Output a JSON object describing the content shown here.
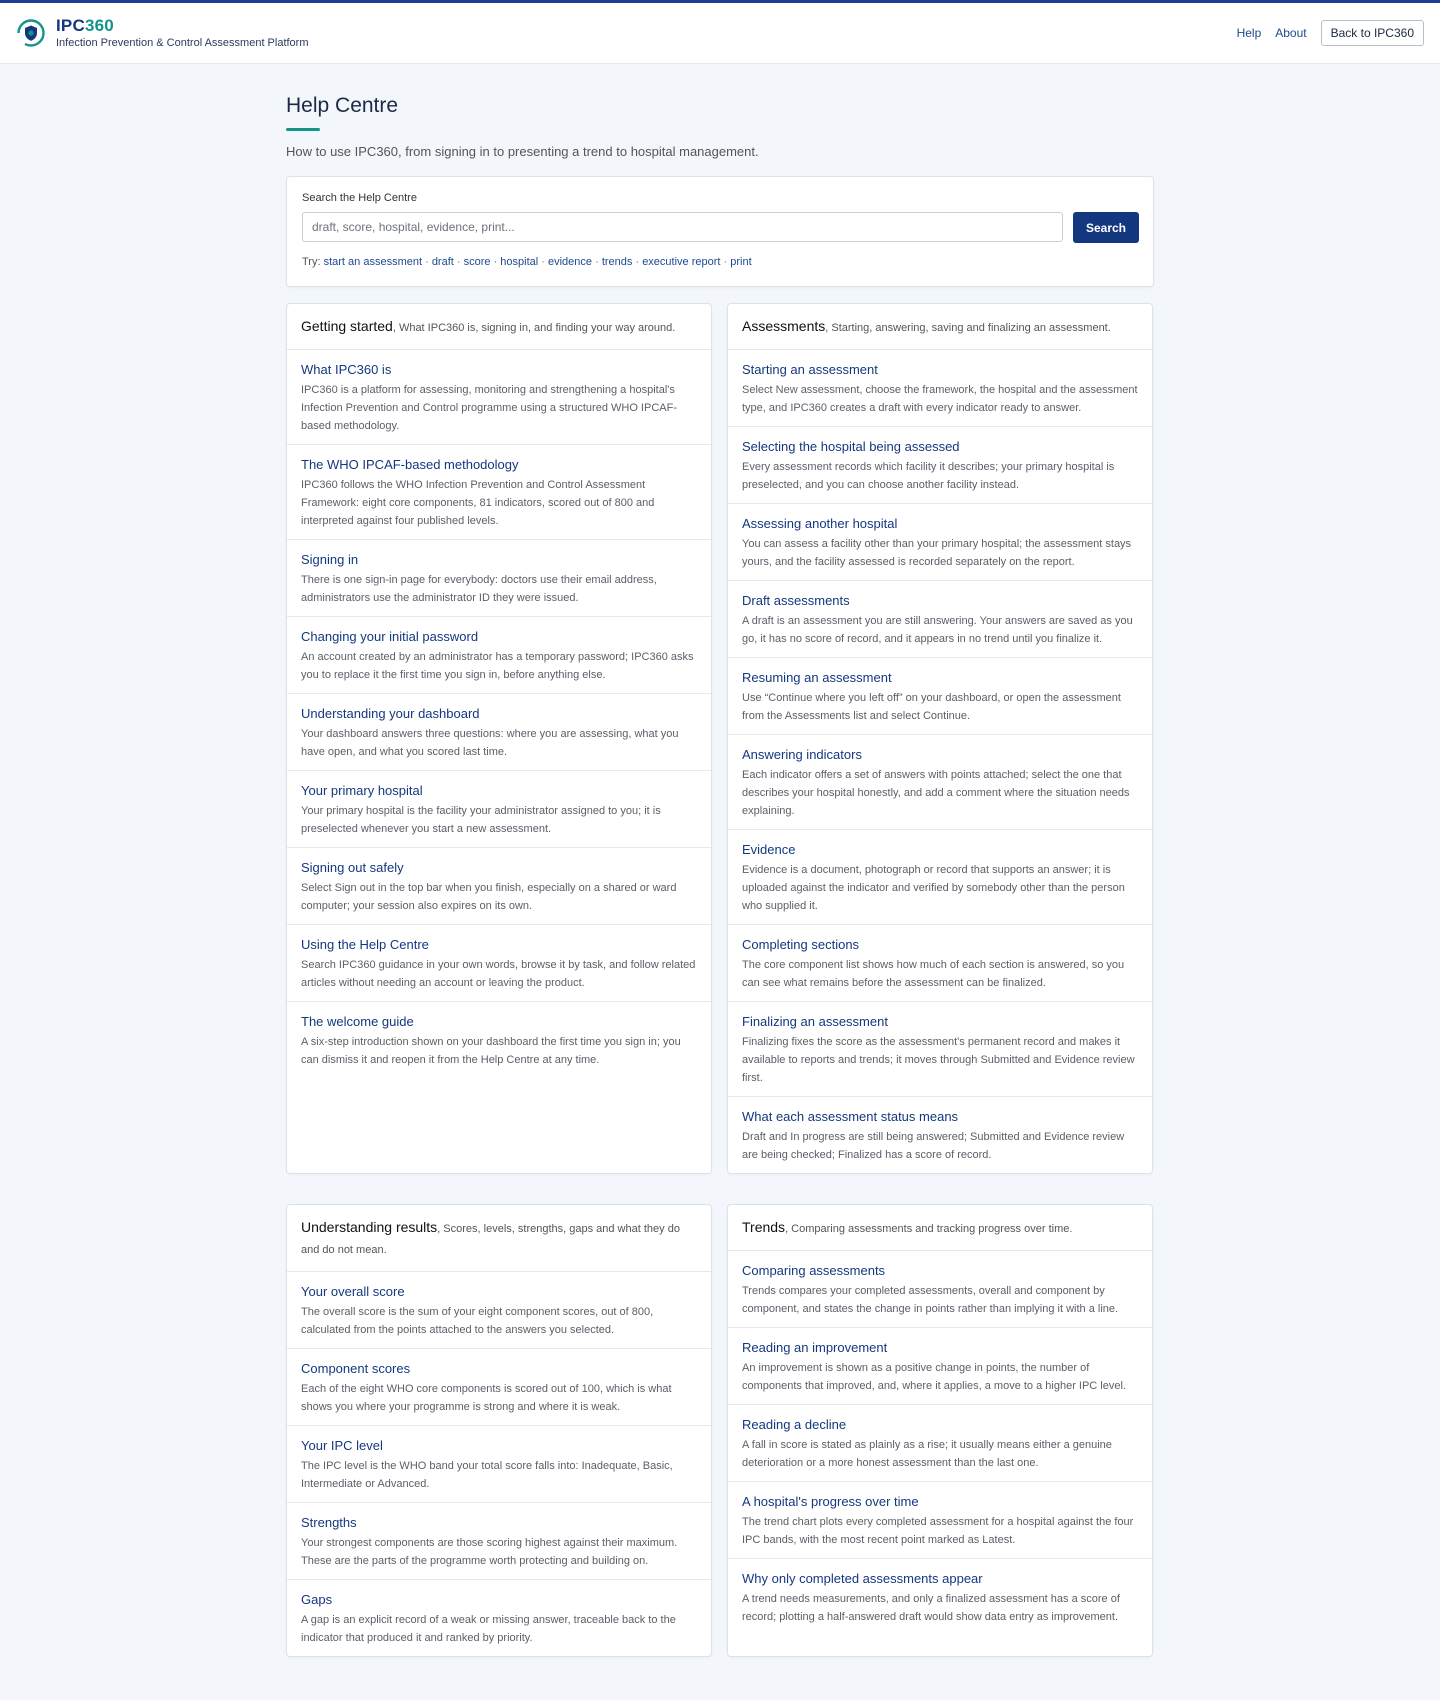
{
  "header": {
    "brand_main": "IPC",
    "brand_accent": "360",
    "brand_sub": "Infection Prevention & Control Assessment Platform",
    "nav_help": "Help",
    "nav_about": "About",
    "back_button": "Back to IPC360"
  },
  "page": {
    "title": "Help Centre",
    "intro": "How to use IPC360, from signing in to presenting a trend to hospital management."
  },
  "search": {
    "label": "Search the Help Centre",
    "placeholder": "draft, score, hospital, evidence, print...",
    "button": "Search",
    "try_label": "Try:",
    "suggestions": [
      "start an assessment",
      "draft",
      "score",
      "hospital",
      "evidence",
      "trends",
      "executive report",
      "print"
    ]
  },
  "sections": [
    {
      "title": "Getting started",
      "desc": ", What IPC360 is, signing in, and finding your way around.",
      "articles": [
        {
          "title": "What IPC360 is",
          "desc": "IPC360 is a platform for assessing, monitoring and strengthening a hospital's Infection Prevention and Control programme using a structured WHO IPCAF-based methodology."
        },
        {
          "title": "The WHO IPCAF-based methodology",
          "desc": "IPC360 follows the WHO Infection Prevention and Control Assessment Framework: eight core components, 81 indicators, scored out of 800 and interpreted against four published levels."
        },
        {
          "title": "Signing in",
          "desc": "There is one sign-in page for everybody: doctors use their email address, administrators use the administrator ID they were issued."
        },
        {
          "title": "Changing your initial password",
          "desc": "An account created by an administrator has a temporary password; IPC360 asks you to replace it the first time you sign in, before anything else."
        },
        {
          "title": "Understanding your dashboard",
          "desc": "Your dashboard answers three questions: where you are assessing, what you have open, and what you scored last time."
        },
        {
          "title": "Your primary hospital",
          "desc": "Your primary hospital is the facility your administrator assigned to you; it is preselected whenever you start a new assessment."
        },
        {
          "title": "Signing out safely",
          "desc": "Select Sign out in the top bar when you finish, especially on a shared or ward computer; your session also expires on its own."
        },
        {
          "title": "Using the Help Centre",
          "desc": "Search IPC360 guidance in your own words, browse it by task, and follow related articles without needing an account or leaving the product."
        },
        {
          "title": "The welcome guide",
          "desc": "A six-step introduction shown on your dashboard the first time you sign in; you can dismiss it and reopen it from the Help Centre at any time."
        }
      ]
    },
    {
      "title": "Assessments",
      "desc": ", Starting, answering, saving and finalizing an assessment.",
      "articles": [
        {
          "title": "Starting an assessment",
          "desc": "Select New assessment, choose the framework, the hospital and the assessment type, and IPC360 creates a draft with every indicator ready to answer."
        },
        {
          "title": "Selecting the hospital being assessed",
          "desc": "Every assessment records which facility it describes; your primary hospital is preselected, and you can choose another facility instead."
        },
        {
          "title": "Assessing another hospital",
          "desc": "You can assess a facility other than your primary hospital; the assessment stays yours, and the facility assessed is recorded separately on the report."
        },
        {
          "title": "Draft assessments",
          "desc": "A draft is an assessment you are still answering. Your answers are saved as you go, it has no score of record, and it appears in no trend until you finalize it."
        },
        {
          "title": "Resuming an assessment",
          "desc": "Use “Continue where you left off” on your dashboard, or open the assessment from the Assessments list and select Continue."
        },
        {
          "title": "Answering indicators",
          "desc": "Each indicator offers a set of answers with points attached; select the one that describes your hospital honestly, and add a comment where the situation needs explaining."
        },
        {
          "title": "Evidence",
          "desc": "Evidence is a document, photograph or record that supports an answer; it is uploaded against the indicator and verified by somebody other than the person who supplied it."
        },
        {
          "title": "Completing sections",
          "desc": "The core component list shows how much of each section is answered, so you can see what remains before the assessment can be finalized."
        },
        {
          "title": "Finalizing an assessment",
          "desc": "Finalizing fixes the score as the assessment's permanent record and makes it available to reports and trends; it moves through Submitted and Evidence review first."
        },
        {
          "title": "What each assessment status means",
          "desc": "Draft and In progress are still being answered; Submitted and Evidence review are being checked; Finalized has a score of record."
        }
      ]
    },
    {
      "title": "Understanding results",
      "desc": ", Scores, levels, strengths, gaps and what they do and do not mean.",
      "articles": [
        {
          "title": "Your overall score",
          "desc": "The overall score is the sum of your eight component scores, out of 800, calculated from the points attached to the answers you selected."
        },
        {
          "title": "Component scores",
          "desc": "Each of the eight WHO core components is scored out of 100, which is what shows you where your programme is strong and where it is weak."
        },
        {
          "title": "Your IPC level",
          "desc": "The IPC level is the WHO band your total score falls into: Inadequate, Basic, Intermediate or Advanced."
        },
        {
          "title": "Strengths",
          "desc": "Your strongest components are those scoring highest against their maximum. These are the parts of the programme worth protecting and building on."
        },
        {
          "title": "Gaps",
          "desc": "A gap is an explicit record of a weak or missing answer, traceable back to the indicator that produced it and ranked by priority."
        }
      ]
    },
    {
      "title": "Trends",
      "desc": ", Comparing assessments and tracking progress over time.",
      "articles": [
        {
          "title": "Comparing assessments",
          "desc": "Trends compares your completed assessments, overall and component by component, and states the change in points rather than implying it with a line."
        },
        {
          "title": "Reading an improvement",
          "desc": "An improvement is shown as a positive change in points, the number of components that improved, and, where it applies, a move to a higher IPC level."
        },
        {
          "title": "Reading a decline",
          "desc": "A fall in score is stated as plainly as a rise; it usually means either a genuine deterioration or a more honest assessment than the last one."
        },
        {
          "title": "A hospital's progress over time",
          "desc": "The trend chart plots every completed assessment for a hospital against the four IPC bands, with the most recent point marked as Latest."
        },
        {
          "title": "Why only completed assessments appear",
          "desc": "A trend needs measurements, and only a finalized assessment has a score of record; plotting a half-answered draft would show data entry as improvement."
        }
      ]
    }
  ],
  "colors": {
    "brand": "#14387f",
    "accent": "#13938a",
    "background": "#f3f6fa"
  }
}
